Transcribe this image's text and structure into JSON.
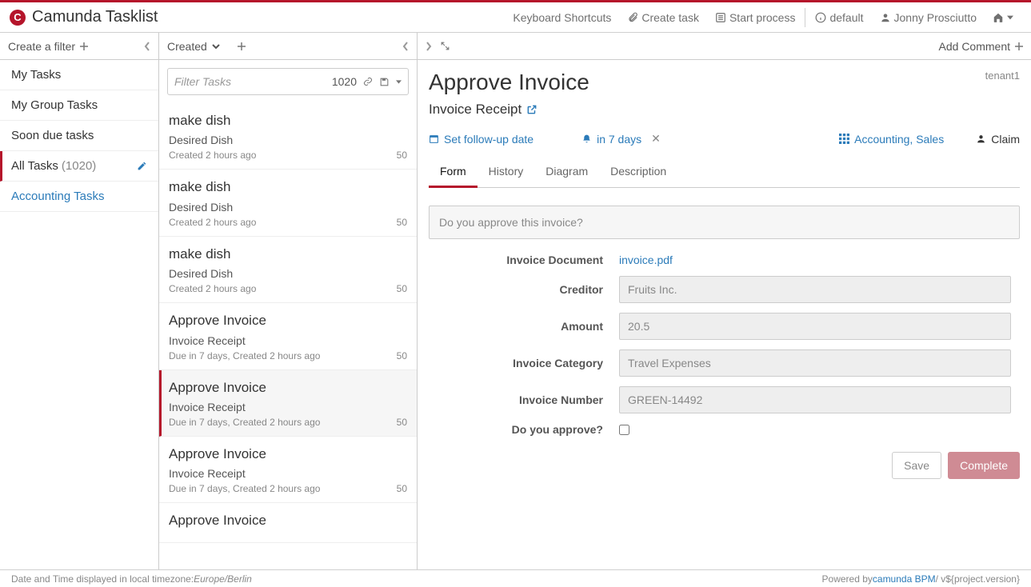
{
  "brand": {
    "logo_letter": "C",
    "title": "Camunda Tasklist"
  },
  "header": {
    "shortcuts": "Keyboard Shortcuts",
    "create_task": "Create task",
    "start_process": "Start process",
    "theme": "default",
    "user": "Jonny Prosciutto"
  },
  "filters_panel": {
    "create_label": "Create a filter",
    "items": [
      {
        "label": "My Tasks",
        "active": false,
        "count": null,
        "link": false
      },
      {
        "label": "My Group Tasks",
        "active": false,
        "count": null,
        "link": false
      },
      {
        "label": "Soon due tasks",
        "active": false,
        "count": null,
        "link": false
      },
      {
        "label": "All Tasks",
        "active": true,
        "count": "(1020)",
        "link": false
      },
      {
        "label": "Accounting Tasks",
        "active": false,
        "count": null,
        "link": true
      }
    ]
  },
  "tasks_panel": {
    "sort_label": "Created",
    "search_placeholder": "Filter Tasks",
    "total": "1020",
    "items": [
      {
        "title": "make dish",
        "sub": "Desired Dish",
        "meta": "Created 2 hours ago",
        "pri": "50",
        "selected": false
      },
      {
        "title": "make dish",
        "sub": "Desired Dish",
        "meta": "Created 2 hours ago",
        "pri": "50",
        "selected": false
      },
      {
        "title": "make dish",
        "sub": "Desired Dish",
        "meta": "Created 2 hours ago",
        "pri": "50",
        "selected": false
      },
      {
        "title": "Approve Invoice",
        "sub": "Invoice Receipt",
        "meta": "Due in 7 days, Created 2 hours ago",
        "pri": "50",
        "selected": false
      },
      {
        "title": "Approve Invoice",
        "sub": "Invoice Receipt",
        "meta": "Due in 7 days, Created 2 hours ago",
        "pri": "50",
        "selected": true
      },
      {
        "title": "Approve Invoice",
        "sub": "Invoice Receipt",
        "meta": "Due in 7 days, Created 2 hours ago",
        "pri": "50",
        "selected": false
      },
      {
        "title": "Approve Invoice",
        "sub": "",
        "meta": "",
        "pri": "",
        "selected": false
      }
    ]
  },
  "detail": {
    "add_comment": "Add Comment",
    "title": "Approve Invoice",
    "tenant": "tenant1",
    "process": "Invoice Receipt",
    "followup": "Set follow-up date",
    "due": "in 7 days",
    "groups": "Accounting, Sales",
    "claim": "Claim",
    "tabs": [
      {
        "label": "Form",
        "active": true
      },
      {
        "label": "History",
        "active": false
      },
      {
        "label": "Diagram",
        "active": false
      },
      {
        "label": "Description",
        "active": false
      }
    ],
    "question": "Do you approve this invoice?",
    "form": {
      "doc_label": "Invoice Document",
      "doc_value": "invoice.pdf",
      "creditor_label": "Creditor",
      "creditor_value": "Fruits Inc.",
      "amount_label": "Amount",
      "amount_value": "20.5",
      "category_label": "Invoice Category",
      "category_value": "Travel Expenses",
      "number_label": "Invoice Number",
      "number_value": "GREEN-14492",
      "approve_label": "Do you approve?"
    },
    "save": "Save",
    "complete": "Complete"
  },
  "footer": {
    "tz_prefix": "Date and Time displayed in local timezone: ",
    "tz": "Europe/Berlin",
    "powered_prefix": "Powered by ",
    "powered_link": "camunda BPM",
    "version": " / v${project.version}"
  }
}
